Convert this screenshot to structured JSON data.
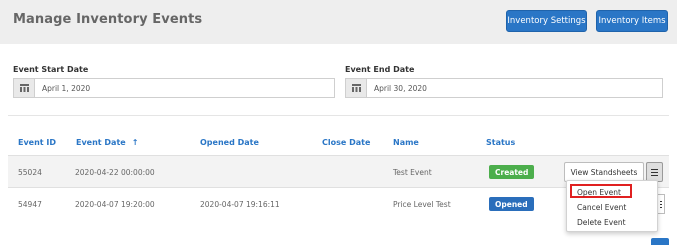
{
  "header": {
    "title": "Manage Inventory Events",
    "buttons": {
      "settings": "Inventory Settings",
      "items": "Inventory Items"
    }
  },
  "filters": {
    "start": {
      "label": "Event Start Date",
      "value": "April 1, 2020",
      "icon": "calendar-icon"
    },
    "end": {
      "label": "Event End Date",
      "value": "April 30, 2020",
      "icon": "calendar-icon"
    }
  },
  "table": {
    "headers": {
      "id": "Event ID",
      "date": "Event Date",
      "opened": "Opened Date",
      "close": "Close Date",
      "name": "Name",
      "status": "Status"
    },
    "sort_icon": "sort-ascending-arrow-icon",
    "sort_glyph": "↑",
    "rows": [
      {
        "id": "55024",
        "date": "2020-04-22 00:00:00",
        "opened": "",
        "close": "",
        "name": "Test Event",
        "status": "Created",
        "action": "View Standsheets"
      },
      {
        "id": "54947",
        "date": "2020-04-07 19:20:00",
        "opened": "2020-04-07 19:16:11",
        "close": "",
        "name": "Price Level Test",
        "status": "Opened"
      }
    ]
  },
  "dropdown": {
    "items": [
      "Open Event",
      "Cancel Event",
      "Delete Event"
    ]
  },
  "colors": {
    "accent": "#2a76c6",
    "created": "#4cae4c",
    "opened": "#2a6ebb",
    "highlight": "#e02020"
  }
}
